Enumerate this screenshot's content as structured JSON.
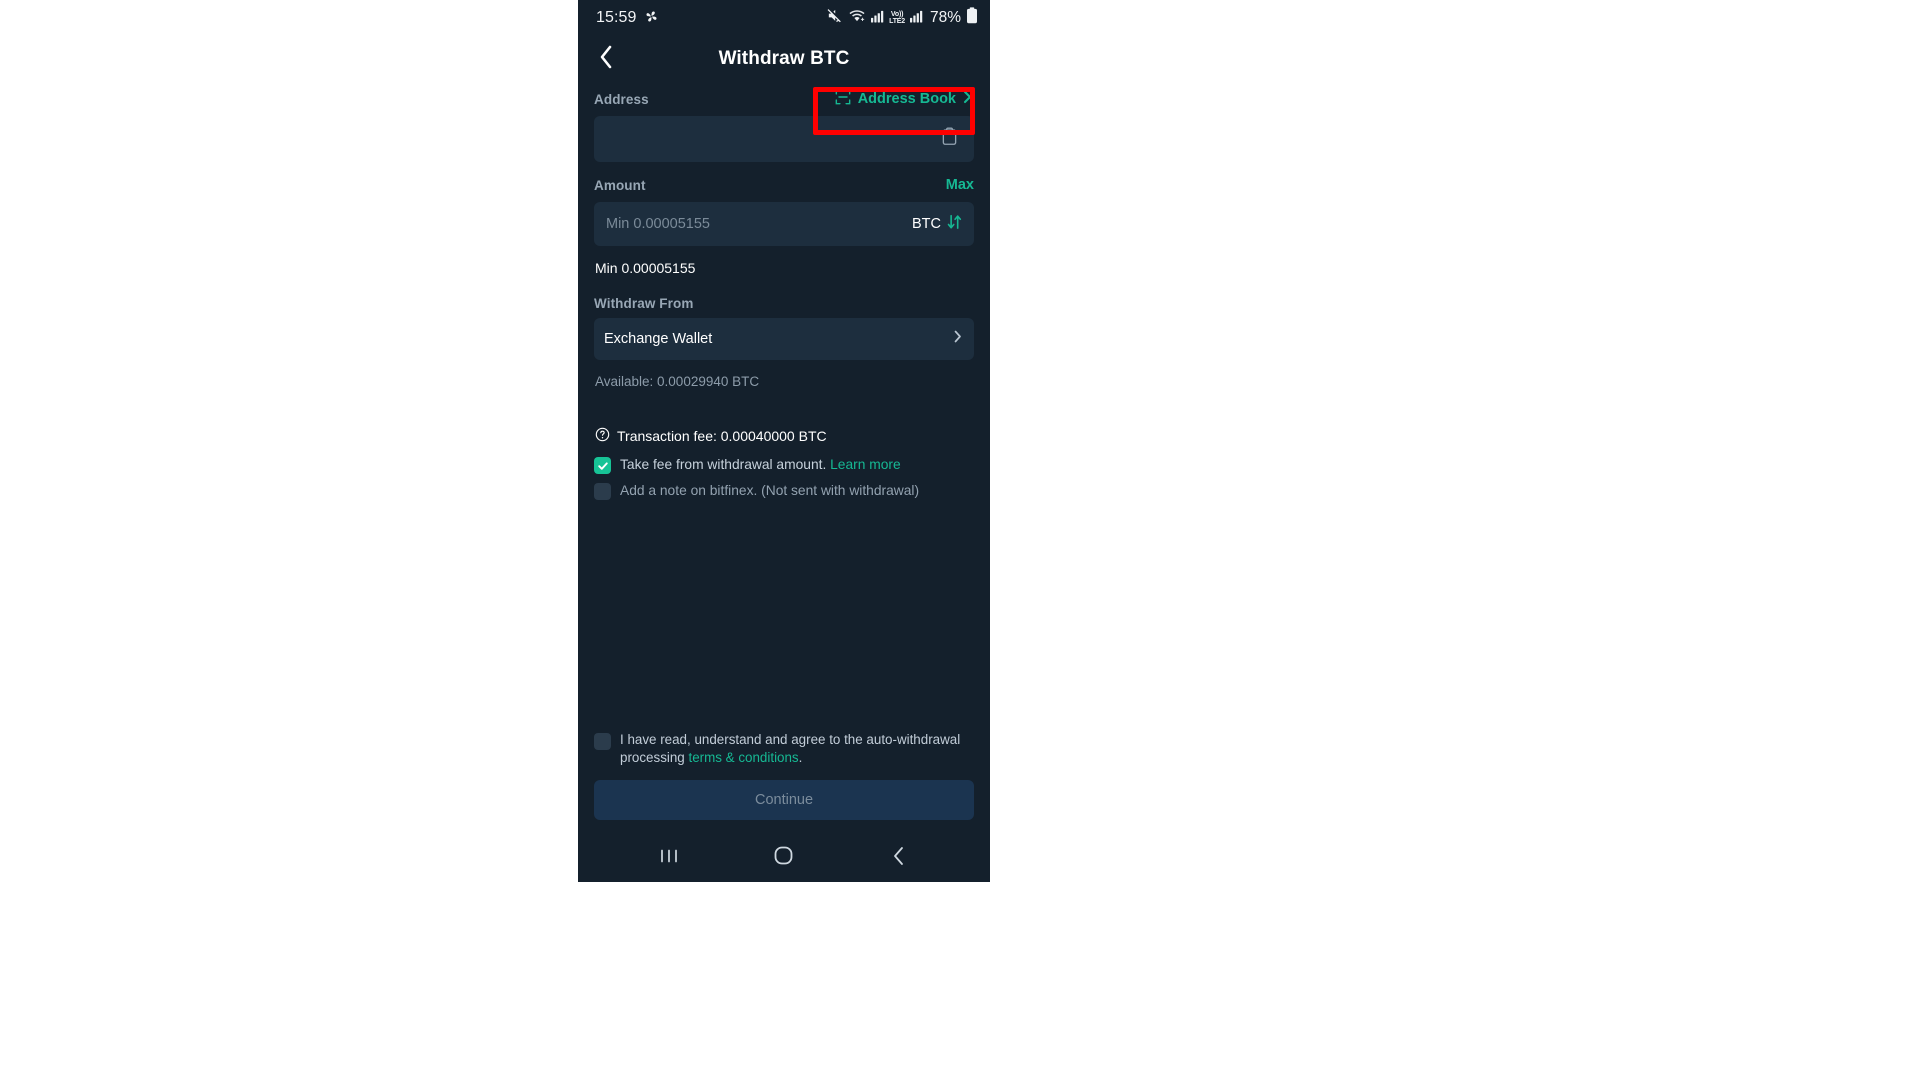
{
  "statusbar": {
    "time": "15:59",
    "pinwheel_icon": "pinwheel-icon",
    "mute_icon": "mute-icon",
    "wifi_icon": "wifi-plus-icon",
    "signal_icon_1": "signal-bars-icon",
    "volte_line1": "Vo))",
    "volte_line2": "LTE2",
    "signal_icon_2": "signal-bars-icon",
    "battery_percent": "78%",
    "battery_icon": "battery-icon"
  },
  "header": {
    "back_icon": "chevron-left-icon",
    "title": "Withdraw BTC"
  },
  "address": {
    "label": "Address",
    "address_book_label": "Address Book",
    "scan_icon": "scan-qr-icon",
    "chevron_icon": "chevron-right-icon",
    "input_value": "",
    "input_placeholder": "",
    "paste_icon": "clipboard-icon"
  },
  "amount": {
    "label": "Amount",
    "max_label": "Max",
    "input_value": "",
    "input_placeholder": "Min 0.00005155",
    "currency": "BTC",
    "swap_icon": "swap-vertical-icon",
    "min_hint": "Min 0.00005155"
  },
  "withdraw_from": {
    "label": "Withdraw From",
    "selected": "Exchange Wallet",
    "chevron_icon": "chevron-right-icon",
    "available": "Available: 0.00029940 BTC"
  },
  "fee": {
    "help_icon": "question-circle-icon",
    "text": "Transaction fee: 0.00040000 BTC",
    "take_fee_checked": true,
    "take_fee_text": "Take fee from withdrawal amount.",
    "take_fee_link": "Learn more",
    "note_checked": false,
    "note_text": "Add a note on bitfinex. (Not sent with withdrawal)"
  },
  "terms": {
    "checked": false,
    "text_part1": "I have read, understand and agree to the auto-withdrawal processing ",
    "link": "terms & conditions",
    "text_part2": "."
  },
  "footer": {
    "continue_label": "Continue"
  },
  "navbar": {
    "recents_icon": "recents-icon",
    "home_icon": "home-icon",
    "back_icon": "back-icon"
  },
  "colors": {
    "accent_green": "#16b893",
    "checkbox_green": "#17c396",
    "page_bg": "#14202c",
    "field_bg": "#1d2e3e",
    "highlight_red": "#ff0000",
    "button_bg": "#1b3450"
  }
}
